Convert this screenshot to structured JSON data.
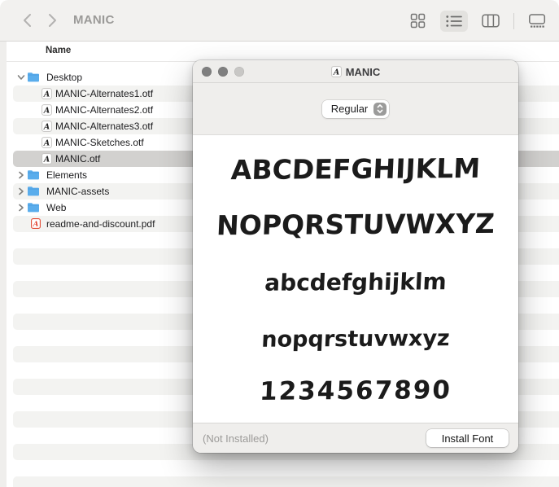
{
  "finder": {
    "toolbar": {
      "title": "MANIC",
      "back_icon": "chevron-left-icon",
      "forward_icon": "chevron-right-icon",
      "view_modes": [
        {
          "name": "grid-view-icon",
          "selected": false
        },
        {
          "name": "list-view-icon",
          "selected": true
        },
        {
          "name": "columns-view-icon",
          "selected": false
        },
        {
          "name": "gallery-view-icon",
          "selected": false
        }
      ]
    },
    "column_header": "Name",
    "rows": [
      {
        "name": "Desktop",
        "type": "folder",
        "level": 0,
        "expanded": true,
        "selected": false
      },
      {
        "name": "MANIC-Alternates1.otf",
        "type": "font",
        "level": 1,
        "selected": false
      },
      {
        "name": "MANIC-Alternates2.otf",
        "type": "font",
        "level": 1,
        "selected": false
      },
      {
        "name": "MANIC-Alternates3.otf",
        "type": "font",
        "level": 1,
        "selected": false
      },
      {
        "name": "MANIC-Sketches.otf",
        "type": "font",
        "level": 1,
        "selected": false
      },
      {
        "name": "MANIC.otf",
        "type": "font",
        "level": 1,
        "selected": true
      },
      {
        "name": "Elements",
        "type": "folder",
        "level": 0,
        "expanded": false,
        "selected": false
      },
      {
        "name": "MANIC-assets",
        "type": "folder",
        "level": 0,
        "expanded": false,
        "selected": false
      },
      {
        "name": "Web",
        "type": "folder",
        "level": 0,
        "expanded": false,
        "selected": false
      },
      {
        "name": "readme-and-discount.pdf",
        "type": "pdf",
        "level": 0,
        "selected": false
      }
    ],
    "empty_row_count": 16
  },
  "preview": {
    "window_title": "MANIC",
    "window_title_icon": "font-file-icon",
    "style_selected": "Regular",
    "glyph_rows": [
      "ABCDEFGHIJKLM",
      "NOPQRSTUVWXYZ",
      "abcdefghijklm",
      "nopqrstuvwxyz",
      "1234567890"
    ],
    "status": "(Not Installed)",
    "install_label": "Install Font"
  },
  "colors": {
    "toolbar_bg": "#f2f1ef",
    "stripe": "#f3f3f1",
    "selection": "#d2d1cf",
    "folder_blue": "#5aadec",
    "pdf_red": "#e23b2a",
    "window_chrome": "#efeeec",
    "inactive_title": "#9b9a98"
  }
}
